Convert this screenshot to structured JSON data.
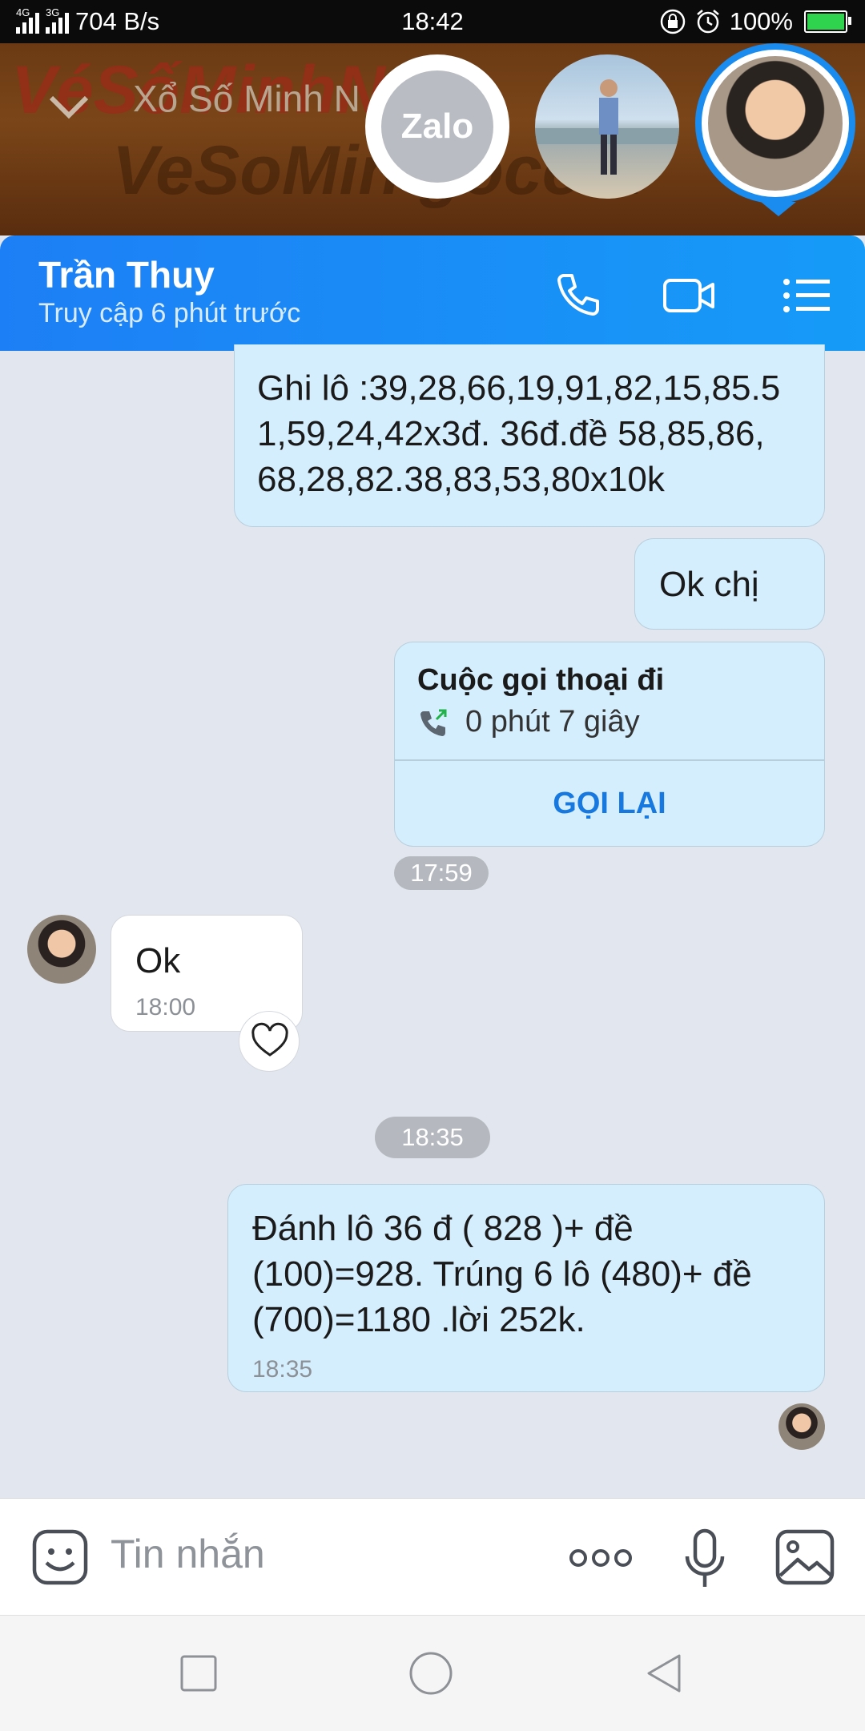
{
  "status_bar": {
    "network_1": "4G",
    "network_2": "3G",
    "data_speed": "704 B/s",
    "time": "18:42",
    "battery": "100%"
  },
  "banner": {
    "title": "Xổ Số Minh N",
    "watermark_1": "VéSốMinhNg",
    "watermark_2": "VeSoMin gocom",
    "bubbles": [
      "Zalo"
    ]
  },
  "header": {
    "name": "Trần Thuy",
    "status": "Truy cập 6 phút trước"
  },
  "messages": {
    "m1_lines": [
      "Ghi lô :39,28,66,19,91,82,15,85.5",
      "1,59,24,42x3đ. 36đ.đề 58,85,86,",
      "68,28,82.38,83,53,80x10k"
    ],
    "m2": "Ok chị",
    "call": {
      "title": "Cuộc gọi thoại đi",
      "duration": "0 phút 7 giây",
      "action": "GỌI LẠI"
    },
    "time_1759": "17:59",
    "m3": "Ok",
    "m3_time": "18:00",
    "time_1835": "18:35",
    "m4_lines": [
      "Đánh lô 36 đ ( 828 )+ đề",
      "(100)=928. Trúng 6 lô (480)+ đề",
      "(700)=1180 .lời 252k."
    ],
    "m4_time": "18:35"
  },
  "input": {
    "placeholder": "Tin nhắn"
  },
  "colors": {
    "header_start": "#1d7ff5",
    "header_end": "#169bf8",
    "outgoing_bubble": "#d5eefd",
    "call_back": "#1779e0"
  }
}
